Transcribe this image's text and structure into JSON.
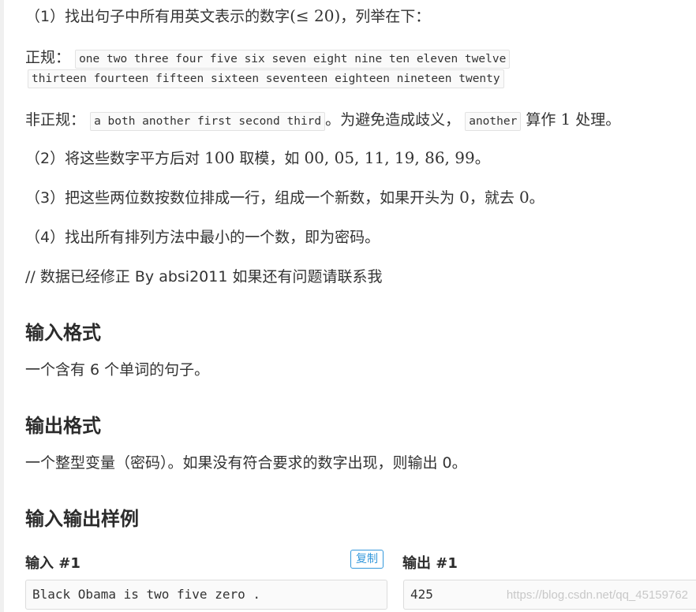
{
  "step1": {
    "prefix": "（1）找出句子中所有用英文表示的数字",
    "math": "(≤ 20)",
    "suffix": "，列举在下："
  },
  "regular": {
    "label": "正规：",
    "line1": "one two three four five six seven eight nine ten eleven twelve",
    "line2": "thirteen fourteen fifteen sixteen seventeen eighteen nineteen twenty"
  },
  "irregular": {
    "label": "非正规：",
    "words": "a both another first second third",
    "mid": "。为避免造成歧义，",
    "another": "another",
    "tail_pre": "算作",
    "tail_num": "1",
    "tail_post": "处理。"
  },
  "step2": {
    "prefix": "（2）将这些数字平方后对",
    "num": "100",
    "mid": "取模，如",
    "examples": "00, 05, 11, 19, 86, 99",
    "end": "。"
  },
  "step3": {
    "prefix": "（3）把这些两位数按数位排成一行，组成一个新数，如果开头为",
    "zero1": "0",
    "mid": "，就去",
    "zero2": "0",
    "end": "。"
  },
  "step4": {
    "text": "（4）找出所有排列方法中最小的一个数，即为密码。"
  },
  "note": "// 数据已经修正 By absi2011 如果还有问题请联系我",
  "input_format": {
    "heading": "输入格式",
    "text": "一个含有 6 个单词的句子。"
  },
  "output_format": {
    "heading": "输出格式",
    "text": "一个整型变量（密码）。如果没有符合要求的数字出现，则输出 0。"
  },
  "samples": {
    "heading": "输入输出样例",
    "input_label": "输入 #1",
    "copy_label": "复制",
    "output_label": "输出 #1",
    "input_value": "Black Obama is two five zero .",
    "output_value": "425"
  },
  "watermark": "https://blog.csdn.net/qq_45159762",
  "colors": {
    "accent": "#3498db",
    "text": "#333333",
    "code_bg": "#fafafa"
  }
}
